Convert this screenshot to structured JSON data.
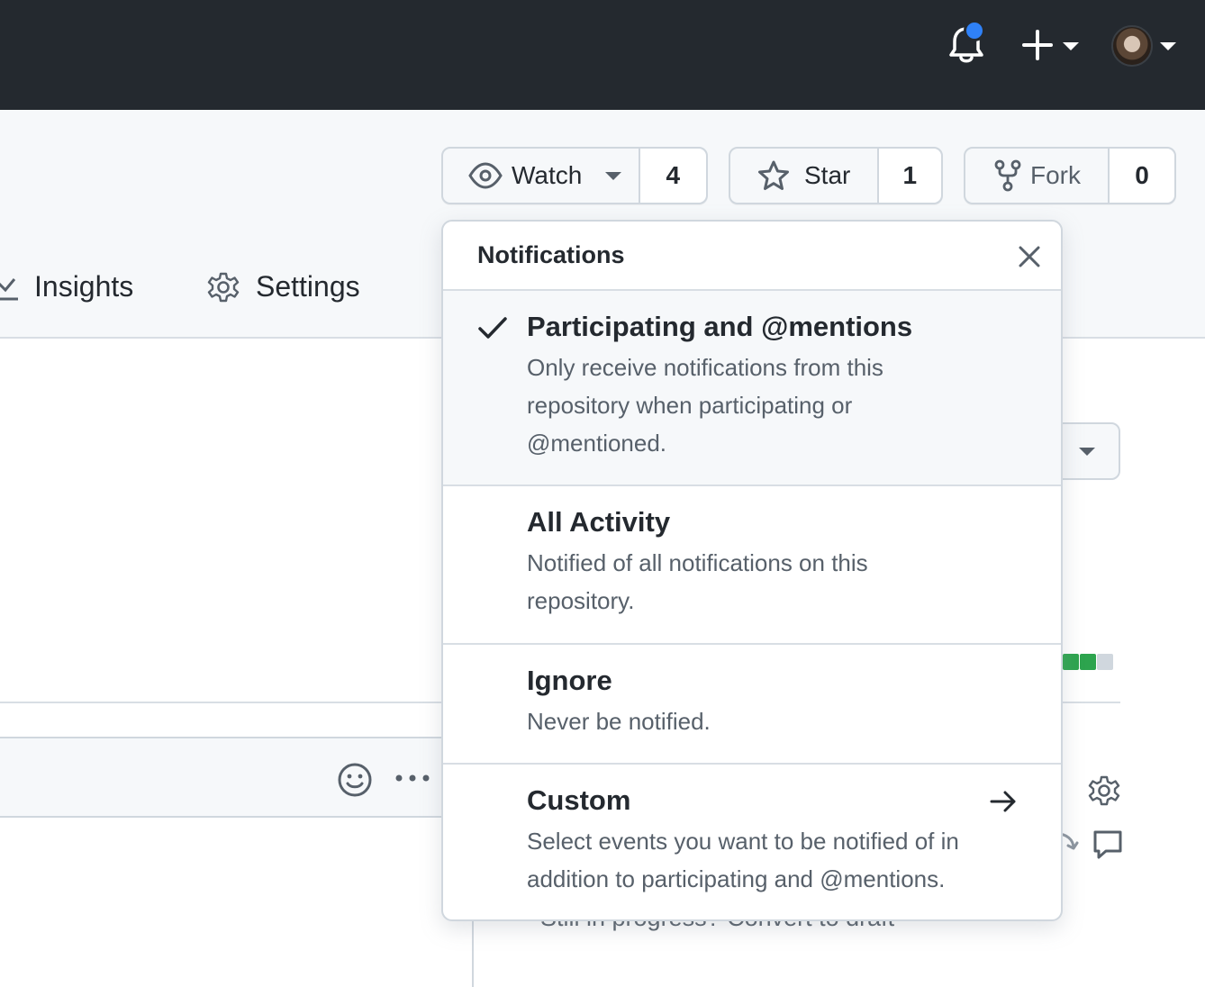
{
  "header": {
    "notifications_icon": "bell-icon",
    "create_icon": "plus-icon",
    "avatar_icon": "avatar"
  },
  "repo_actions": {
    "watch": {
      "label": "Watch",
      "count": "4",
      "icon": "eye-icon"
    },
    "star": {
      "label": "Star",
      "count": "1",
      "icon": "star-icon"
    },
    "fork": {
      "label": "Fork",
      "count": "0",
      "icon": "fork-icon"
    }
  },
  "tabs": [
    {
      "label": "Insights",
      "icon": "graph-icon"
    },
    {
      "label": "Settings",
      "icon": "gear-icon"
    }
  ],
  "background": {
    "draft_text": "Still in progress? Convert to draft"
  },
  "notifications_menu": {
    "title": "Notifications",
    "options": [
      {
        "title": "Participating and @mentions",
        "description": "Only receive notifications from this repository when participating or @mentioned.",
        "selected": true
      },
      {
        "title": "All Activity",
        "description": "Notified of all notifications on this repository.",
        "selected": false
      },
      {
        "title": "Ignore",
        "description": "Never be notified.",
        "selected": false
      },
      {
        "title": "Custom",
        "description": "Select events you want to be notified of in addition to participating and @mentions.",
        "selected": false
      }
    ]
  },
  "colors": {
    "header_bg": "#24292f",
    "notification_dot": "#2f81f7",
    "activity_green": "#2da44e"
  }
}
